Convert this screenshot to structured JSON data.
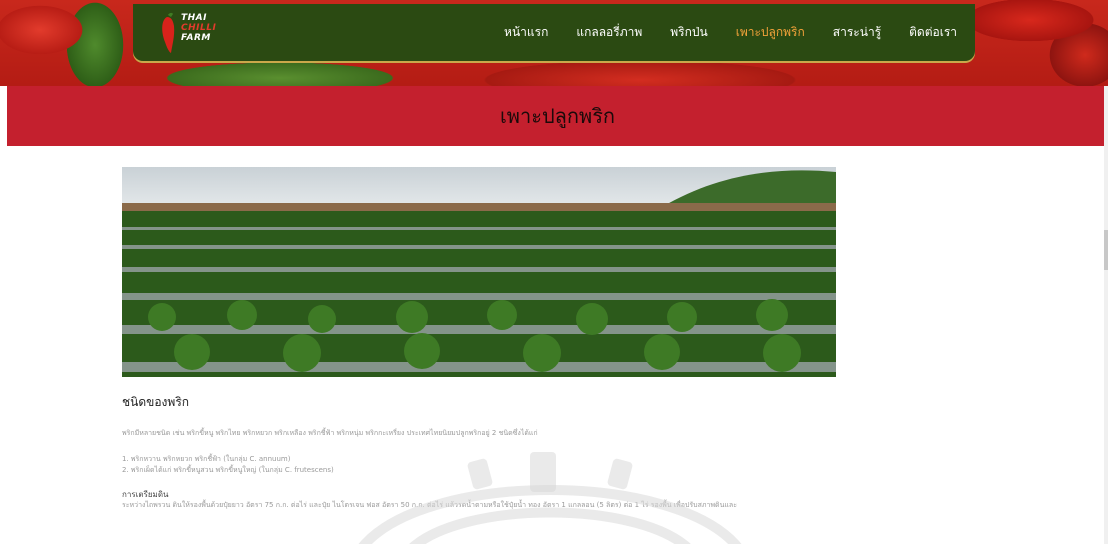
{
  "logo": {
    "line1": "THAI",
    "line2": "CHILLI",
    "line3": "FARM"
  },
  "nav": {
    "items": [
      {
        "label": "หน้าแรก",
        "active": false
      },
      {
        "label": "แกลลอรี่ภาพ",
        "active": false
      },
      {
        "label": "พริกป่น",
        "active": false
      },
      {
        "label": "เพาะปลูกพริก",
        "active": true
      },
      {
        "label": "สาระน่ารู้",
        "active": false
      },
      {
        "label": "ติดต่อเรา",
        "active": false
      }
    ]
  },
  "page_title": "เพาะปลูกพริก",
  "section": {
    "heading": "ชนิดของพริก",
    "intro": "พริกมีหลายชนิด เช่น พริกขี้หนู พริกไทย พริกหยวก พริกเหลือง พริกชี้ฟ้า พริกหนุ่ม พริกกะเหรี่ยง ประเทศไทยนิยมปลูกพริกอยู่ 2 ชนิดซึ่งได้แก่",
    "list": [
      "1. พริกหวาน พริกหยวก พริกชี้ฟ้า (ในกลุ่ม C. annuum)",
      "2. พริกเผ็ดได้แก่ พริกขี้หนูสวน พริกขี้หนูใหญ่ (ในกลุ่ม C. frutescens)"
    ],
    "prep_heading": "การเตรียมดิน",
    "prep_text": "ระหว่างไถพรวน ดินให้รองพื้นด้วยปุ๋ยยาว อัตรา 75 ก.ก. ต่อไร่ และปุ๋ย ไนโตรเจน ฟอส อัตรา 50 ก.ก. ต่อไร่ แล้วรดน้ำตามหรือใช้ปุ๋ยน้ำ ทอง อัตรา 1 แกลลอน (5 ลิตร) ต่อ 1 ไร่ รองพื้น เพื่อปรับสภาพดินและ"
  },
  "colors": {
    "nav_bg": "#2b4a12",
    "title_band": "#c4202e",
    "active_link": "#f2a23a"
  }
}
